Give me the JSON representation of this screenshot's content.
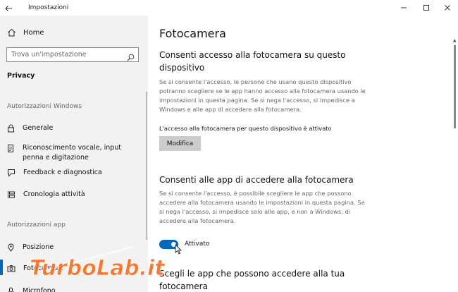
{
  "window": {
    "title": "Impostazioni"
  },
  "sidebar": {
    "home_label": "Home",
    "search_placeholder": "Trova un'impostazione",
    "current_section": "Privacy",
    "group_windows": "Autorizzazioni Windows",
    "items_windows": [
      {
        "label": "Generale",
        "icon": "lock-icon"
      },
      {
        "label": "Riconoscimento vocale, input penna e digitazione",
        "icon": "document-pen-icon"
      },
      {
        "label": "Feedback e diagnostica",
        "icon": "feedback-icon"
      },
      {
        "label": "Cronologia attività",
        "icon": "timeline-icon"
      }
    ],
    "group_apps": "Autorizzazioni app",
    "items_apps": [
      {
        "label": "Posizione",
        "icon": "location-icon"
      },
      {
        "label": "Fotocamera",
        "icon": "camera-icon",
        "selected": true
      },
      {
        "label": "Microfono",
        "icon": "microphone-icon"
      }
    ]
  },
  "main": {
    "page_title": "Fotocamera",
    "section1": {
      "heading": "Consenti accesso alla fotocamera su questo dispositivo",
      "description": "Se si consente l'accesso, le persone che usano questo dispositivo potranno scegliere se le app hanno accesso alla fotocamera usando le impostazioni in questa pagina. Se si nega l'accesso, si impedisce a Windows e alle app di accedere alla fotocamera.",
      "status": "L'accesso alla fotocamera per questo dispositivo è attivato",
      "button_label": "Modifica"
    },
    "section2": {
      "heading": "Consenti alle app di accedere alla fotocamera",
      "description": "Se si consente l'accesso, è possibile scegliere le app che possono accedere alla fotocamera usando le impostazioni in questa pagina. Se si nega l'accesso, si impedisce solo alle app, e non a Windows, di accedere alla fotocamera.",
      "toggle_label": "Attivato",
      "toggle_on": true
    },
    "section3": {
      "heading": "Scegli le app che possono accedere alla tua fotocamera"
    }
  },
  "watermark": {
    "text": "TurboLab.it"
  },
  "colors": {
    "accent": "#0067c0",
    "sidebar_bg": "#f2f2f2",
    "button_bg": "#cccccc",
    "watermark": "#ff6a1a"
  }
}
